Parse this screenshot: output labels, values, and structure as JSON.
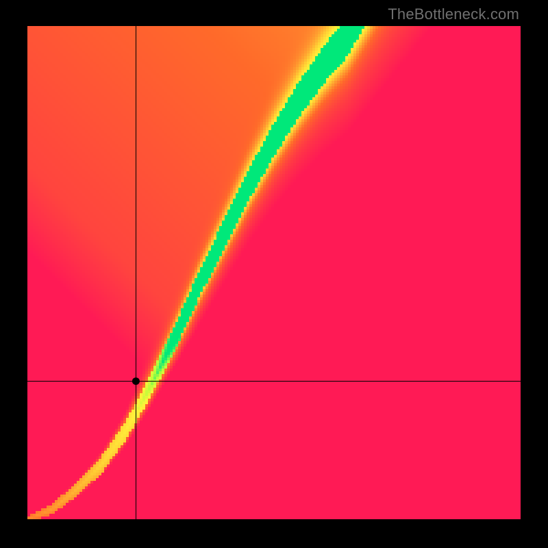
{
  "watermark": "TheBottleneck.com",
  "chart_data": {
    "type": "heatmap",
    "title": "",
    "xlabel": "",
    "ylabel": "",
    "x_range": [
      0,
      1
    ],
    "y_range": [
      0,
      1
    ],
    "resolution": 180,
    "colormap": {
      "stops": [
        {
          "t": 0.0,
          "color": "#ff1a55"
        },
        {
          "t": 0.4,
          "color": "#ff6a2a"
        },
        {
          "t": 0.7,
          "color": "#ffd335"
        },
        {
          "t": 0.85,
          "color": "#fff23a"
        },
        {
          "t": 0.93,
          "color": "#b6ff3a"
        },
        {
          "t": 1.0,
          "color": "#00e87a"
        }
      ]
    },
    "ridge": {
      "comment": "optimal-GPU-for-CPU curve; normalized 0..1 both axes, origin bottom-left",
      "points": [
        {
          "x": 0.0,
          "y": 0.0
        },
        {
          "x": 0.05,
          "y": 0.02
        },
        {
          "x": 0.1,
          "y": 0.06
        },
        {
          "x": 0.15,
          "y": 0.11
        },
        {
          "x": 0.2,
          "y": 0.18
        },
        {
          "x": 0.25,
          "y": 0.27
        },
        {
          "x": 0.3,
          "y": 0.37
        },
        {
          "x": 0.35,
          "y": 0.48
        },
        {
          "x": 0.4,
          "y": 0.58
        },
        {
          "x": 0.45,
          "y": 0.68
        },
        {
          "x": 0.5,
          "y": 0.77
        },
        {
          "x": 0.55,
          "y": 0.85
        },
        {
          "x": 0.6,
          "y": 0.92
        },
        {
          "x": 0.65,
          "y": 0.98
        },
        {
          "x": 1.0,
          "y": 1.6
        }
      ],
      "width_start": 0.01,
      "width_end": 0.09
    },
    "marker": {
      "x": 0.22,
      "y": 0.28
    },
    "crosshair": {
      "x": 0.22,
      "y": 0.28
    },
    "field_falloff": 2.8,
    "base_glow": {
      "corner": "tr",
      "strength": 0.55
    }
  }
}
